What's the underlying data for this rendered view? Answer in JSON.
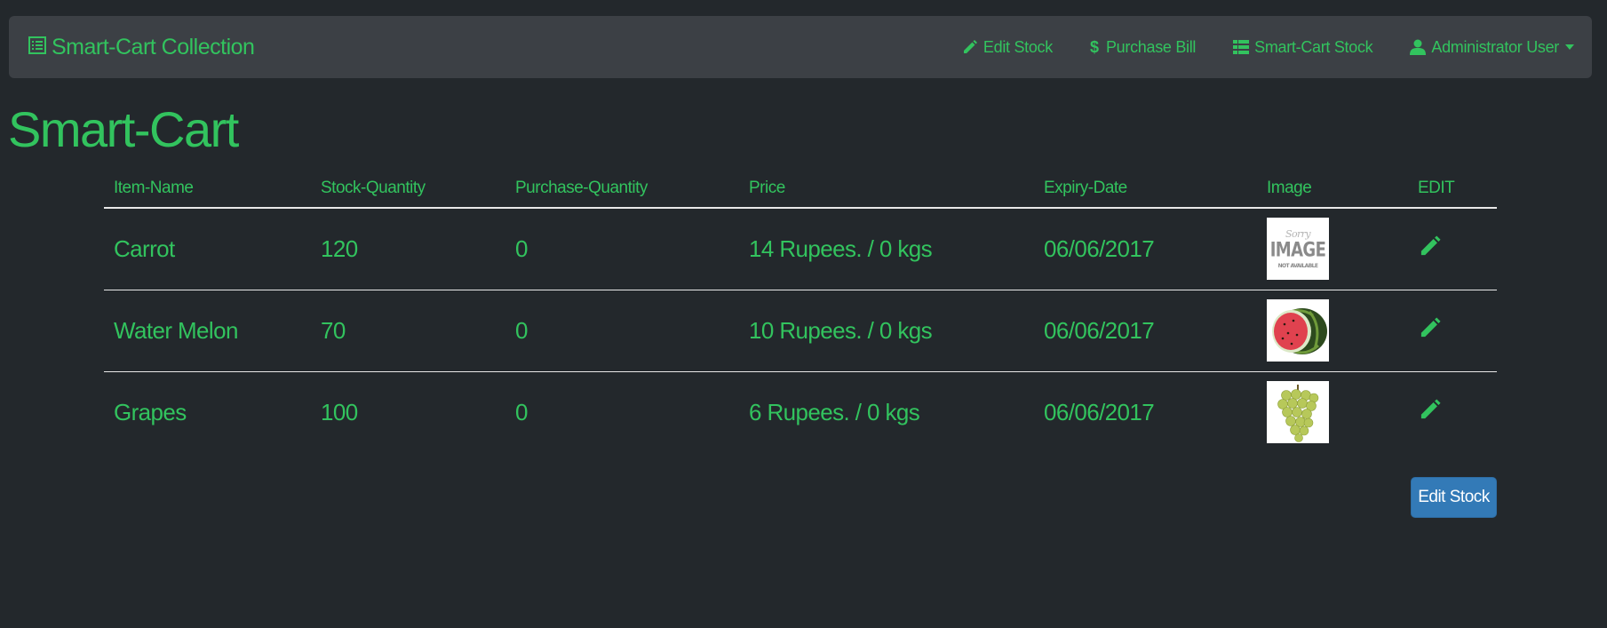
{
  "navbar": {
    "brand": "Smart-Cart Collection",
    "links": [
      {
        "label": "Edit Stock",
        "icon": "pencil-icon"
      },
      {
        "label": "Purchase Bill",
        "icon": "dollar-icon"
      },
      {
        "label": "Smart-Cart Stock",
        "icon": "th-list-icon"
      },
      {
        "label": "Administrator User",
        "icon": "user-icon"
      }
    ]
  },
  "page": {
    "title": "Smart-Cart"
  },
  "table": {
    "headers": [
      "Item-Name",
      "Stock-Quantity",
      "Purchase-Quantity",
      "Price",
      "Expiry-Date",
      "Image",
      "EDIT"
    ],
    "rows": [
      {
        "name": "Carrot",
        "stock": "120",
        "purchase": "0",
        "price": "14 Rupees. / 0 kgs",
        "expiry": "06/06/2017",
        "image": "image-not-available"
      },
      {
        "name": "Water Melon",
        "stock": "70",
        "purchase": "0",
        "price": "10 Rupees. / 0 kgs",
        "expiry": "06/06/2017",
        "image": "watermelon"
      },
      {
        "name": "Grapes",
        "stock": "100",
        "purchase": "0",
        "price": "6 Rupees. / 0 kgs",
        "expiry": "06/06/2017",
        "image": "grapes"
      }
    ]
  },
  "placeholder_image": {
    "line1": "Sorry",
    "line2": "IMAGE",
    "line3": "NOT AVAILABLE"
  },
  "actions": {
    "edit_stock_button": "Edit Stock"
  },
  "colors": {
    "background": "#23282c",
    "navbar": "#3c4045",
    "accent_green": "#32c35e",
    "button_blue": "#337ab7"
  }
}
